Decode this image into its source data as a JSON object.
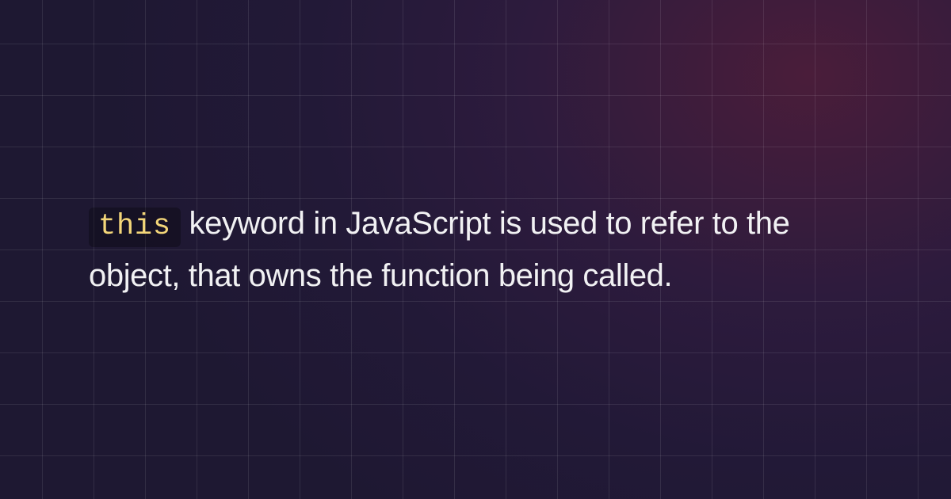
{
  "content": {
    "code_keyword": "this",
    "description_rest": " keyword in JavaScript is used to refer to the object, that owns the function being called."
  },
  "colors": {
    "code_bg": "rgba(0, 0, 0, 0.28)",
    "code_text": "#f3d679",
    "body_text": "#f1f1f3"
  }
}
